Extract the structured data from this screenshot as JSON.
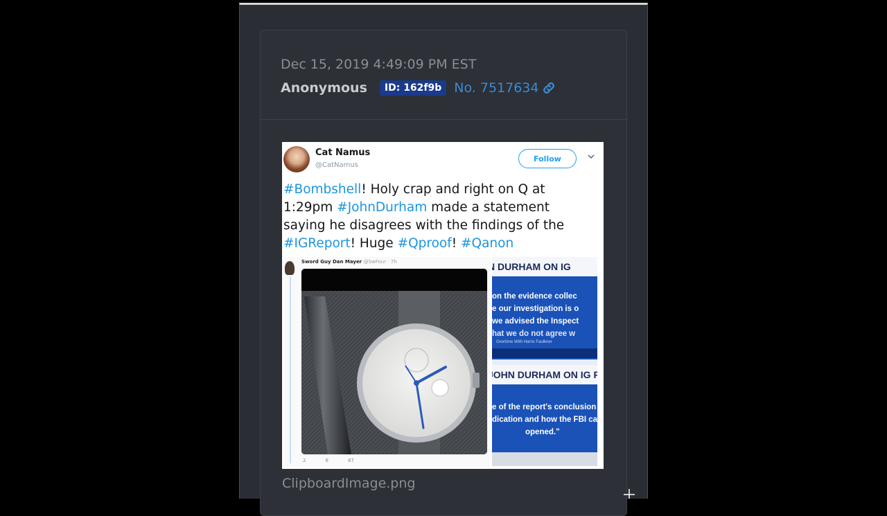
{
  "post": {
    "timestamp": "Dec 15, 2019 4:49:09 PM EST",
    "author": "Anonymous",
    "poster_id": "ID: 162f9b",
    "post_number": "No. 7517634",
    "attachment_filename": "ClipboardImage.png"
  },
  "tweet": {
    "name": "Cat Namus",
    "handle": "@CatNamus",
    "follow_label": "Follow",
    "text_parts": [
      {
        "text": "#Bombshell",
        "hashtag": true
      },
      {
        "text": "! Holy crap and right on Q at 1:29pm ",
        "hashtag": false
      },
      {
        "text": "#JohnDurham",
        "hashtag": true
      },
      {
        "text": " made a statement saying he disagrees with the findings of the ",
        "hashtag": false
      },
      {
        "text": "#IGReport",
        "hashtag": true
      },
      {
        "text": "! Huge ",
        "hashtag": false
      },
      {
        "text": "#Qproof",
        "hashtag": true
      },
      {
        "text": "! ",
        "hashtag": false
      },
      {
        "text": "#Qanon",
        "hashtag": true
      }
    ],
    "embedded": {
      "inner_author": "Sword Guy Dan Mayer",
      "inner_handle": "@SwFour · 7h",
      "inner_actions": [
        "2",
        "6",
        "87"
      ],
      "news_panels": [
        {
          "headline": "N DURHAM ON IG",
          "quote_lines": [
            "on the evidence collec",
            "e our investigation is o",
            "we advised the Inspect",
            "hat we do not agree w"
          ],
          "caption": "Overtime With Harris Faulkner"
        },
        {
          "headline": "JOHN DURHAM ON IG RE",
          "quote_lines": [
            "e of the report's conclusion",
            "dication and how the FBI ca",
            "opened.\""
          ],
          "caption": ""
        }
      ]
    }
  },
  "colors": {
    "page_bg": "#2a2d33",
    "card_bg": "#2d3036",
    "id_badge": "#1a3a8a",
    "link": "#3a8ad6",
    "hashtag": "#1b95e0",
    "news_blue": "#1a52b8"
  },
  "icons": {
    "link": "link-icon",
    "caret": "chevron-down-icon"
  }
}
